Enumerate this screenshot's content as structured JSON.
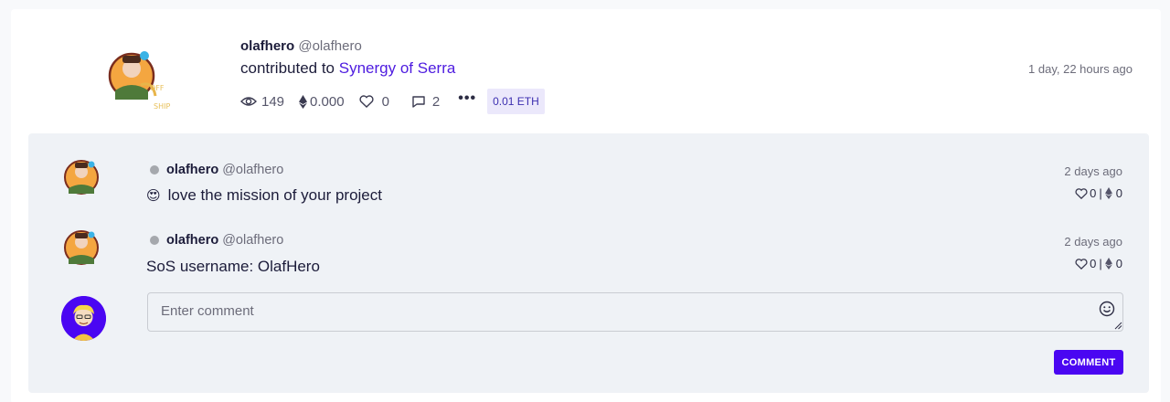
{
  "post": {
    "username": "olafhero",
    "handle": "@olafhero",
    "action_text": "contributed to",
    "project_link": "Synergy of Serra",
    "time": "1 day, 22 hours ago",
    "stats": {
      "views": "149",
      "eth": "0.000",
      "likes": "0",
      "comments": "2",
      "more": "•••"
    },
    "eth_badge": "0.01 ETH"
  },
  "comments": [
    {
      "username": "olafhero",
      "handle": "@olafhero",
      "emoji": "😍",
      "text": "love the mission of your project",
      "time": "2 days ago",
      "likes": "0",
      "eth": "0"
    },
    {
      "username": "olafhero",
      "handle": "@olafhero",
      "text": "SoS username: OlafHero",
      "time": "2 days ago",
      "likes": "0",
      "eth": "0"
    }
  ],
  "composer": {
    "placeholder": "Enter comment",
    "button_label": "COMMENT"
  },
  "colors": {
    "accent": "#4a06f2",
    "link": "#4f1de0",
    "panel_bg": "#eff2f6",
    "badge_bg": "#ebe8fb"
  }
}
